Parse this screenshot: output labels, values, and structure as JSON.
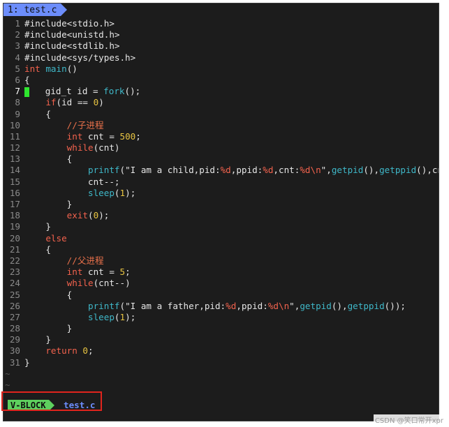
{
  "tabline": {
    "tab_label": "1: test.c"
  },
  "editor": {
    "cursor_line": 7,
    "lines": [
      {
        "n": "1",
        "segs": [
          [
            "pre",
            "#include<stdio.h>"
          ]
        ]
      },
      {
        "n": "2",
        "segs": [
          [
            "pre",
            "#include<unistd.h>"
          ]
        ]
      },
      {
        "n": "3",
        "segs": [
          [
            "pre",
            "#include<stdlib.h>"
          ]
        ]
      },
      {
        "n": "4",
        "segs": [
          [
            "pre",
            "#include<sys/types.h>"
          ]
        ]
      },
      {
        "n": "5",
        "segs": [
          [
            "ty",
            "int "
          ],
          [
            "fn",
            "main"
          ],
          [
            "txt",
            "()"
          ]
        ]
      },
      {
        "n": "6",
        "segs": [
          [
            "txt",
            "{"
          ]
        ]
      },
      {
        "n": "7",
        "segs": [
          [
            "cursor",
            ""
          ],
          [
            "txt",
            "   gid_t id = "
          ],
          [
            "fn",
            "fork"
          ],
          [
            "txt",
            "();"
          ]
        ]
      },
      {
        "n": "8",
        "segs": [
          [
            "txt",
            "    "
          ],
          [
            "kw",
            "if"
          ],
          [
            "txt",
            "(id == "
          ],
          [
            "num",
            "0"
          ],
          [
            "txt",
            ")"
          ]
        ]
      },
      {
        "n": "9",
        "segs": [
          [
            "txt",
            "    {"
          ]
        ]
      },
      {
        "n": "10",
        "segs": [
          [
            "txt",
            "        "
          ],
          [
            "cmt",
            "//子进程"
          ]
        ]
      },
      {
        "n": "11",
        "segs": [
          [
            "txt",
            "        "
          ],
          [
            "ty",
            "int"
          ],
          [
            "txt",
            " cnt = "
          ],
          [
            "num",
            "500"
          ],
          [
            "txt",
            ";"
          ]
        ]
      },
      {
        "n": "12",
        "segs": [
          [
            "txt",
            "        "
          ],
          [
            "kw",
            "while"
          ],
          [
            "txt",
            "(cnt)"
          ]
        ]
      },
      {
        "n": "13",
        "segs": [
          [
            "txt",
            "        {"
          ]
        ]
      },
      {
        "n": "14",
        "segs": [
          [
            "txt",
            "            "
          ],
          [
            "fn",
            "printf"
          ],
          [
            "txt",
            "(\"I am a child,pid:"
          ],
          [
            "fmt",
            "%d"
          ],
          [
            "txt",
            ",ppid:"
          ],
          [
            "fmt",
            "%d"
          ],
          [
            "txt",
            ",cnt:"
          ],
          [
            "fmt",
            "%d\\n"
          ],
          [
            "txt",
            "\","
          ],
          [
            "fn",
            "getpid"
          ],
          [
            "txt",
            "(),"
          ],
          [
            "fn",
            "getppid"
          ],
          [
            "txt",
            "(),cnt);"
          ]
        ]
      },
      {
        "n": "15",
        "segs": [
          [
            "txt",
            "            cnt--;"
          ]
        ]
      },
      {
        "n": "16",
        "segs": [
          [
            "txt",
            "            "
          ],
          [
            "fn",
            "sleep"
          ],
          [
            "txt",
            "("
          ],
          [
            "num",
            "1"
          ],
          [
            "txt",
            ");"
          ]
        ]
      },
      {
        "n": "17",
        "segs": [
          [
            "txt",
            "        }"
          ]
        ]
      },
      {
        "n": "18",
        "segs": [
          [
            "txt",
            "        "
          ],
          [
            "kw",
            "exit"
          ],
          [
            "txt",
            "("
          ],
          [
            "num",
            "0"
          ],
          [
            "txt",
            ");"
          ]
        ]
      },
      {
        "n": "19",
        "segs": [
          [
            "txt",
            "    }"
          ]
        ]
      },
      {
        "n": "20",
        "segs": [
          [
            "txt",
            "    "
          ],
          [
            "kw",
            "else"
          ]
        ]
      },
      {
        "n": "21",
        "segs": [
          [
            "txt",
            "    {"
          ]
        ]
      },
      {
        "n": "22",
        "segs": [
          [
            "txt",
            "        "
          ],
          [
            "cmt",
            "//父进程"
          ]
        ]
      },
      {
        "n": "23",
        "segs": [
          [
            "txt",
            "        "
          ],
          [
            "ty",
            "int"
          ],
          [
            "txt",
            " cnt = "
          ],
          [
            "num",
            "5"
          ],
          [
            "txt",
            ";"
          ]
        ]
      },
      {
        "n": "24",
        "segs": [
          [
            "txt",
            "        "
          ],
          [
            "kw",
            "while"
          ],
          [
            "txt",
            "(cnt--)"
          ]
        ]
      },
      {
        "n": "25",
        "segs": [
          [
            "txt",
            "        {"
          ]
        ]
      },
      {
        "n": "26",
        "segs": [
          [
            "txt",
            "            "
          ],
          [
            "fn",
            "printf"
          ],
          [
            "txt",
            "(\"I am a father,pid:"
          ],
          [
            "fmt",
            "%d"
          ],
          [
            "txt",
            ",ppid:"
          ],
          [
            "fmt",
            "%d\\n"
          ],
          [
            "txt",
            "\","
          ],
          [
            "fn",
            "getpid"
          ],
          [
            "txt",
            "(),"
          ],
          [
            "fn",
            "getppid"
          ],
          [
            "txt",
            "());"
          ]
        ]
      },
      {
        "n": "27",
        "segs": [
          [
            "txt",
            "            "
          ],
          [
            "fn",
            "sleep"
          ],
          [
            "txt",
            "("
          ],
          [
            "num",
            "1"
          ],
          [
            "txt",
            ");"
          ]
        ]
      },
      {
        "n": "28",
        "segs": [
          [
            "txt",
            "        }"
          ]
        ]
      },
      {
        "n": "29",
        "segs": [
          [
            "txt",
            "    }"
          ]
        ]
      },
      {
        "n": "30",
        "segs": [
          [
            "txt",
            "    "
          ],
          [
            "kw",
            "return "
          ],
          [
            "num",
            "0"
          ],
          [
            "txt",
            ";"
          ]
        ]
      },
      {
        "n": "31",
        "segs": [
          [
            "txt",
            "}"
          ]
        ]
      }
    ],
    "tildes": [
      "~",
      "~"
    ]
  },
  "statusline": {
    "mode": "V-BLOCK",
    "filename": "test.c"
  },
  "colors": {
    "background": "#1c1c1c",
    "tab_bg": "#6c8dfb",
    "mode_bg": "#5ed05e",
    "highlight_border": "#e0241d",
    "keyword": "#f2624d",
    "function": "#3fb8c9",
    "number": "#e8c442",
    "comment": "#e8704a",
    "cursor": "#2ee62e"
  },
  "watermark": "CSDN @笑口常开xpr"
}
